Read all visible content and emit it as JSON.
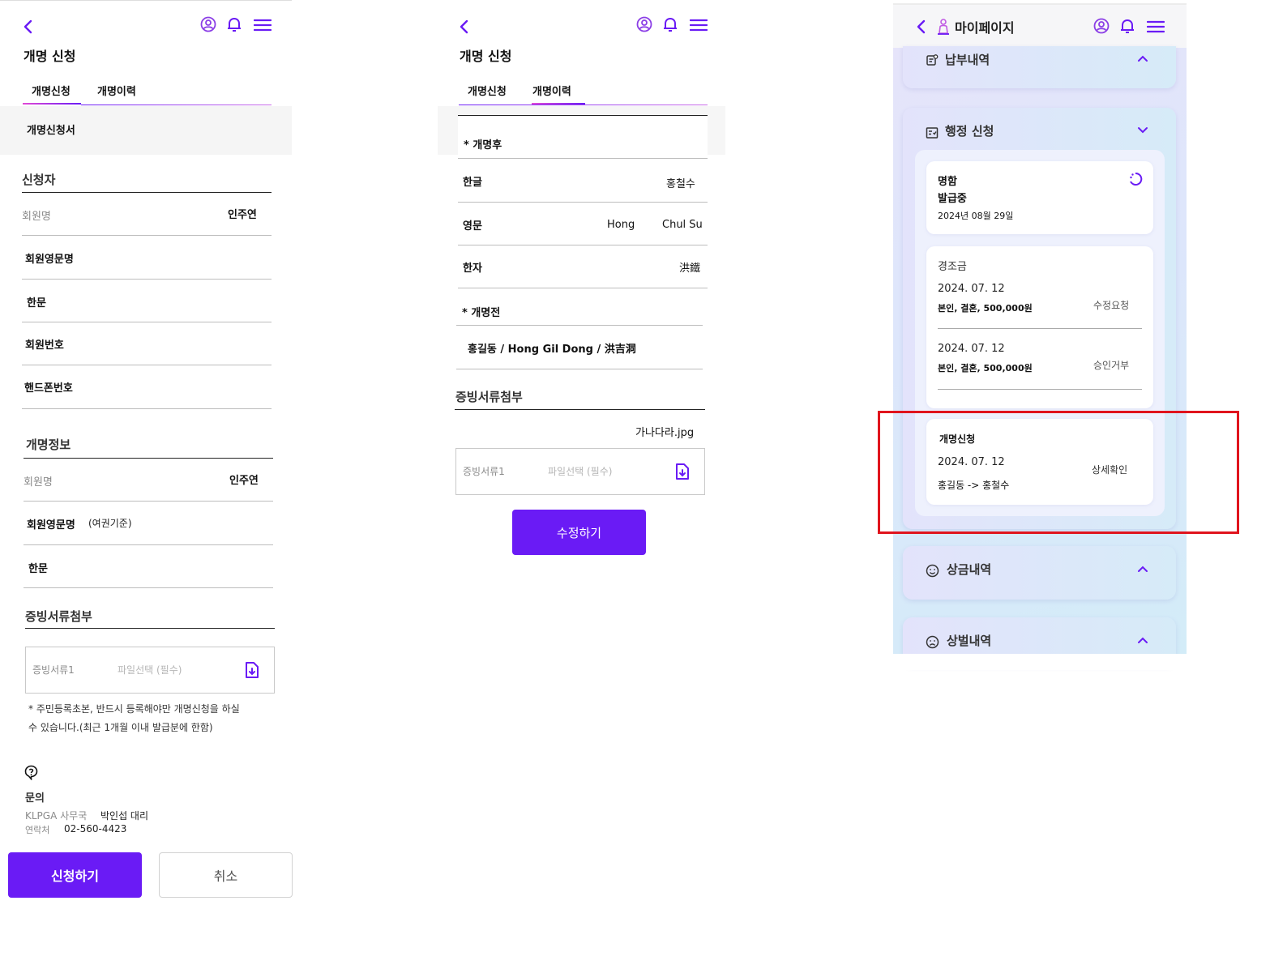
{
  "panel1": {
    "page_title": "개명 신청",
    "tabs": [
      {
        "label": "개명신청",
        "active": true
      },
      {
        "label": "개명이력",
        "active": false
      }
    ],
    "form_title": "개명신청서",
    "applicant": {
      "section": "신청자",
      "member_name_label": "회원명",
      "member_name_value": "인주연",
      "english_name_label": "회원영문명",
      "hanja_label": "한문",
      "member_no_label": "회원번호",
      "phone_label": "핸드폰번호"
    },
    "rename_info": {
      "section": "개명정보",
      "member_name_label": "회원명",
      "member_name_value": "인주연",
      "english_name_label": "회원영문명",
      "english_name_note": "(여권기준)",
      "hanja_label": "한문"
    },
    "attach": {
      "section": "증빙서류첨부",
      "doc_label": "증빙서류1",
      "placeholder": "파일선택 (필수)",
      "note_line1": "* 주민등록초본, 반드시 등록해야만 개명신청을 하실",
      "note_line2": "수 있습니다.(최근 1개월 이내 발급분에 한함)"
    },
    "inquiry": {
      "title": "문의",
      "org_label": "KLPGA 사무국",
      "person": "박인섭 대리",
      "contact_label": "연락처",
      "phone": "02-560-4423"
    },
    "submit_label": "신청하기",
    "cancel_label": "취소"
  },
  "panel2": {
    "page_title": "개명 신청",
    "tabs": [
      {
        "label": "개명신청",
        "active": false
      },
      {
        "label": "개명이력",
        "active": true
      }
    ],
    "after": {
      "section": "* 개명후",
      "hangul_label": "한글",
      "hangul_value": "홍철수",
      "english_label": "영문",
      "english_last": "Hong",
      "english_first": "Chul Su",
      "hanja_label": "한자",
      "hanja_value": "洪鐵"
    },
    "before": {
      "section": "* 개명전",
      "value": "홍길동 / Hong Gil Dong / 洪吉洞"
    },
    "attach": {
      "section": "증빙서류첨부",
      "file_name": "가나다라.jpg",
      "doc_label": "증빙서류1",
      "placeholder": "파일선택 (필수)"
    },
    "edit_label": "수정하기"
  },
  "panel3": {
    "title": "마이페이지",
    "payment": {
      "label": "납부내역"
    },
    "admin": {
      "label": "행정 신청",
      "card1": {
        "line1": "명함",
        "line2": "발급중",
        "date": "2024년 08월 29일"
      },
      "card2": {
        "title": "경조금",
        "item1": {
          "date": "2024. 07. 12",
          "detail": "본인, 결혼, 500,000원",
          "status": "수정요청"
        },
        "item2": {
          "date": "2024. 07. 12",
          "detail": "본인, 결혼, 500,000원",
          "status": "승인거부"
        }
      },
      "card3": {
        "title": "개명신청",
        "date": "2024. 07. 12",
        "detail": "홍길동 -> 홍철수",
        "status": "상세확인"
      }
    },
    "prize": {
      "label": "상금내역"
    },
    "penalty": {
      "label": "상벌내역"
    }
  },
  "colors": {
    "accent": "#6a1bf5",
    "highlight": "#e0141d"
  }
}
